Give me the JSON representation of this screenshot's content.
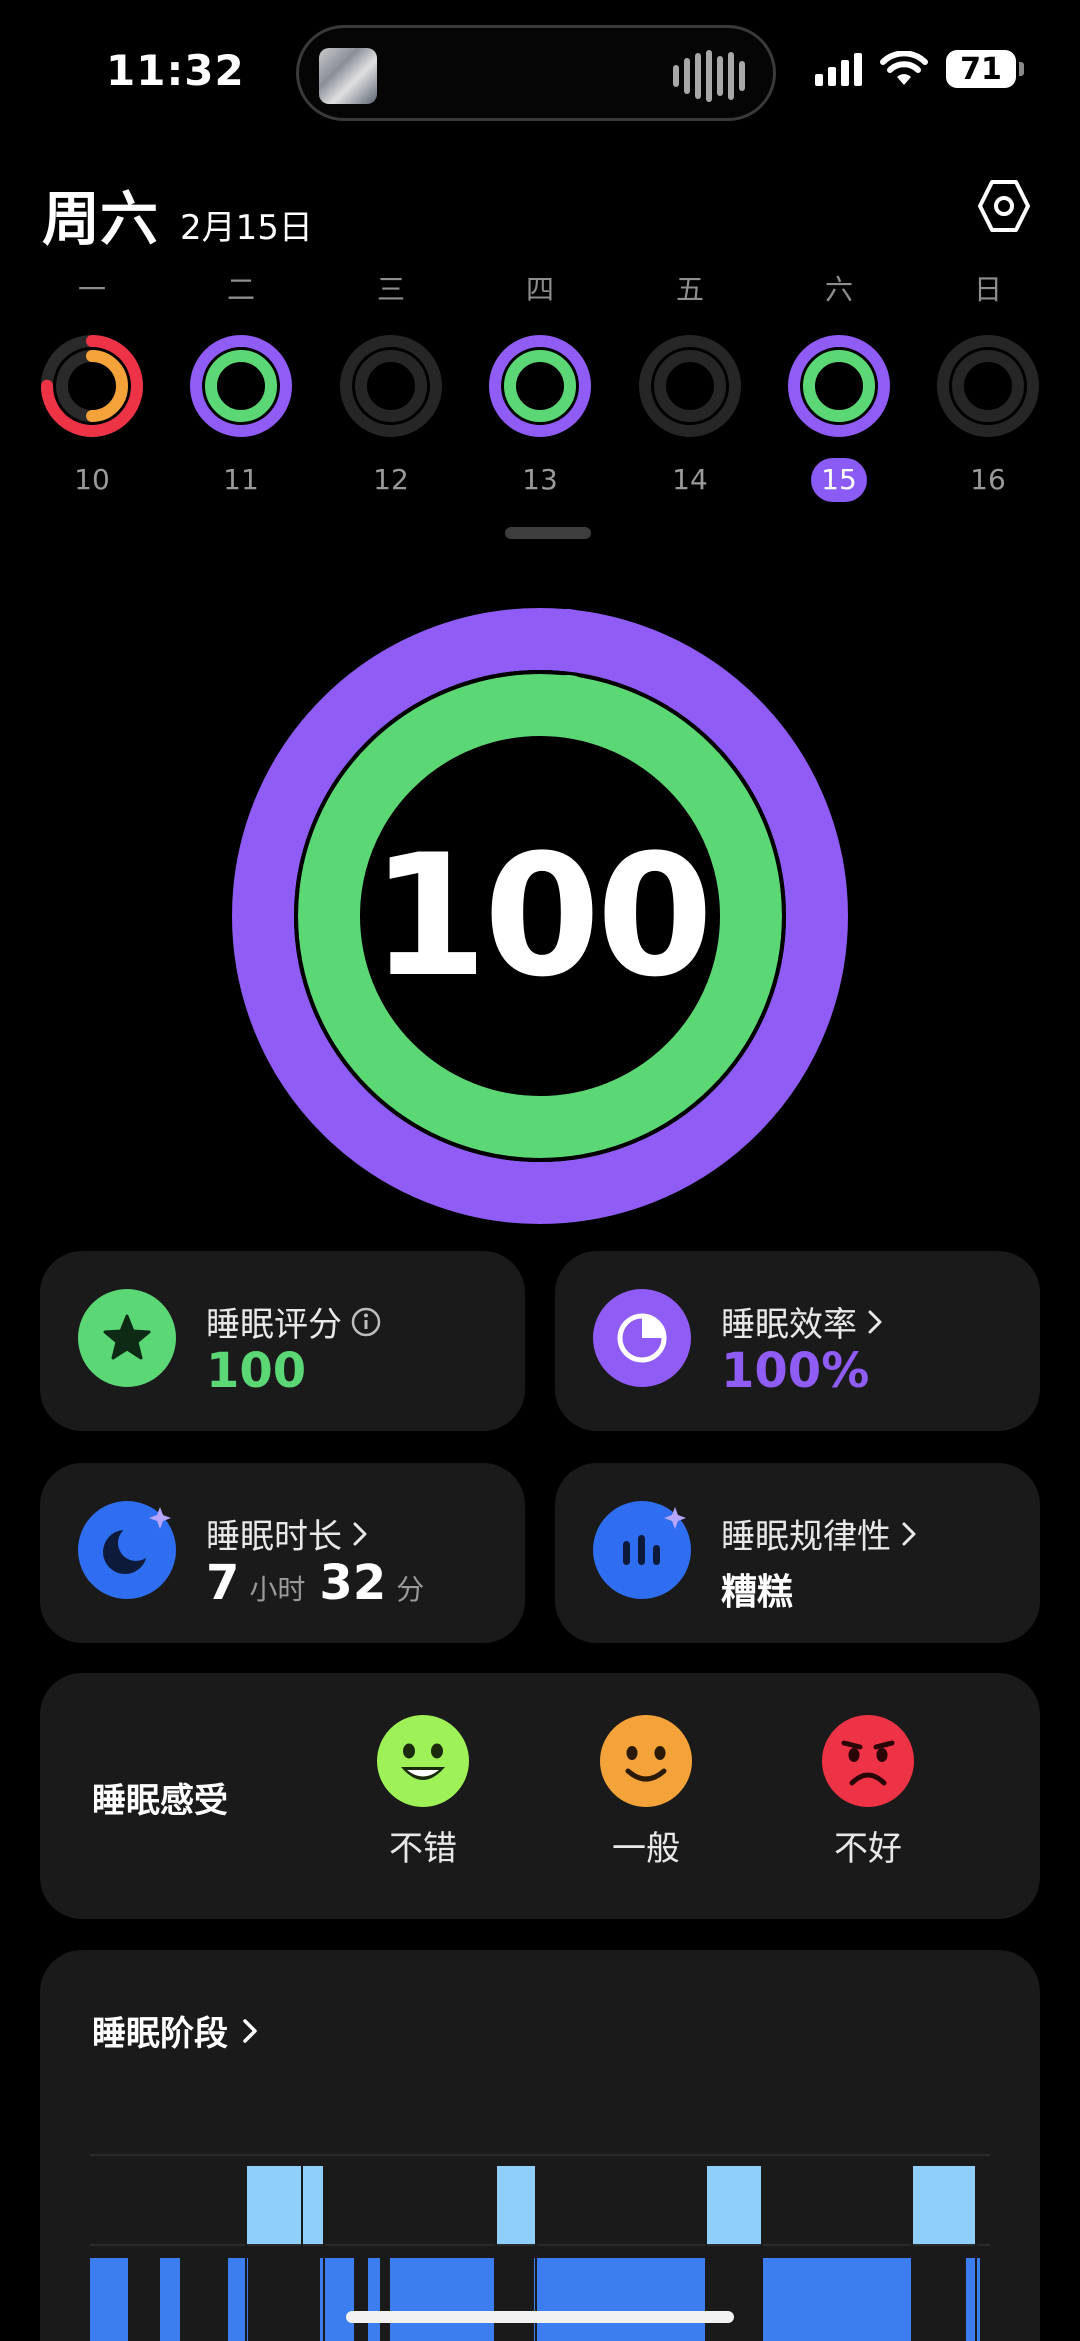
{
  "status_bar": {
    "time": "11:32",
    "battery": "71",
    "icons": [
      "island-thumbnail",
      "audio-wave-icon",
      "cellular-signal-icon",
      "wifi-icon",
      "battery-icon"
    ]
  },
  "header": {
    "day": "周六",
    "date": "2月15日",
    "settings_icon": "settings-hexagon-icon"
  },
  "week": {
    "days": [
      {
        "weekday": "一",
        "date": "10",
        "ring": "red-orange",
        "selected": false
      },
      {
        "weekday": "二",
        "date": "11",
        "ring": "purple-green",
        "selected": false
      },
      {
        "weekday": "三",
        "date": "12",
        "ring": "empty",
        "selected": false
      },
      {
        "weekday": "四",
        "date": "13",
        "ring": "purple-green",
        "selected": false
      },
      {
        "weekday": "五",
        "date": "14",
        "ring": "empty",
        "selected": false
      },
      {
        "weekday": "六",
        "date": "15",
        "ring": "purple-green",
        "selected": true
      },
      {
        "weekday": "日",
        "date": "16",
        "ring": "empty",
        "selected": false
      }
    ]
  },
  "score": {
    "value": "100",
    "outer_ring_fraction": 1.0,
    "inner_ring_fraction": 1.0
  },
  "cards": {
    "score_card": {
      "title": "睡眠评分",
      "value": "100",
      "icon": "star-icon"
    },
    "efficiency_card": {
      "title": "睡眠效率",
      "value": "100%",
      "icon": "pie-icon"
    },
    "duration_card": {
      "title": "睡眠时长",
      "hours": "7",
      "hours_unit": "小时",
      "minutes": "32",
      "minutes_unit": "分",
      "icon": "moon-icon"
    },
    "regularity_card": {
      "title": "睡眠规律性",
      "value": "糟糕",
      "icon": "bars-icon"
    }
  },
  "feeling": {
    "title": "睡眠感受",
    "options": [
      {
        "label": "不错",
        "icon": "happy-face-icon"
      },
      {
        "label": "一般",
        "icon": "neutral-face-icon"
      },
      {
        "label": "不好",
        "icon": "sad-face-icon"
      }
    ]
  },
  "stages": {
    "title": "睡眠阶段"
  },
  "colors": {
    "purple": "#8f5cf5",
    "green": "#5cd776",
    "red": "#ef3346",
    "orange": "#f3a33a",
    "blue": "#3c7ef0",
    "light_blue": "#8ed0fb",
    "card_bg": "#1a1a1a"
  }
}
